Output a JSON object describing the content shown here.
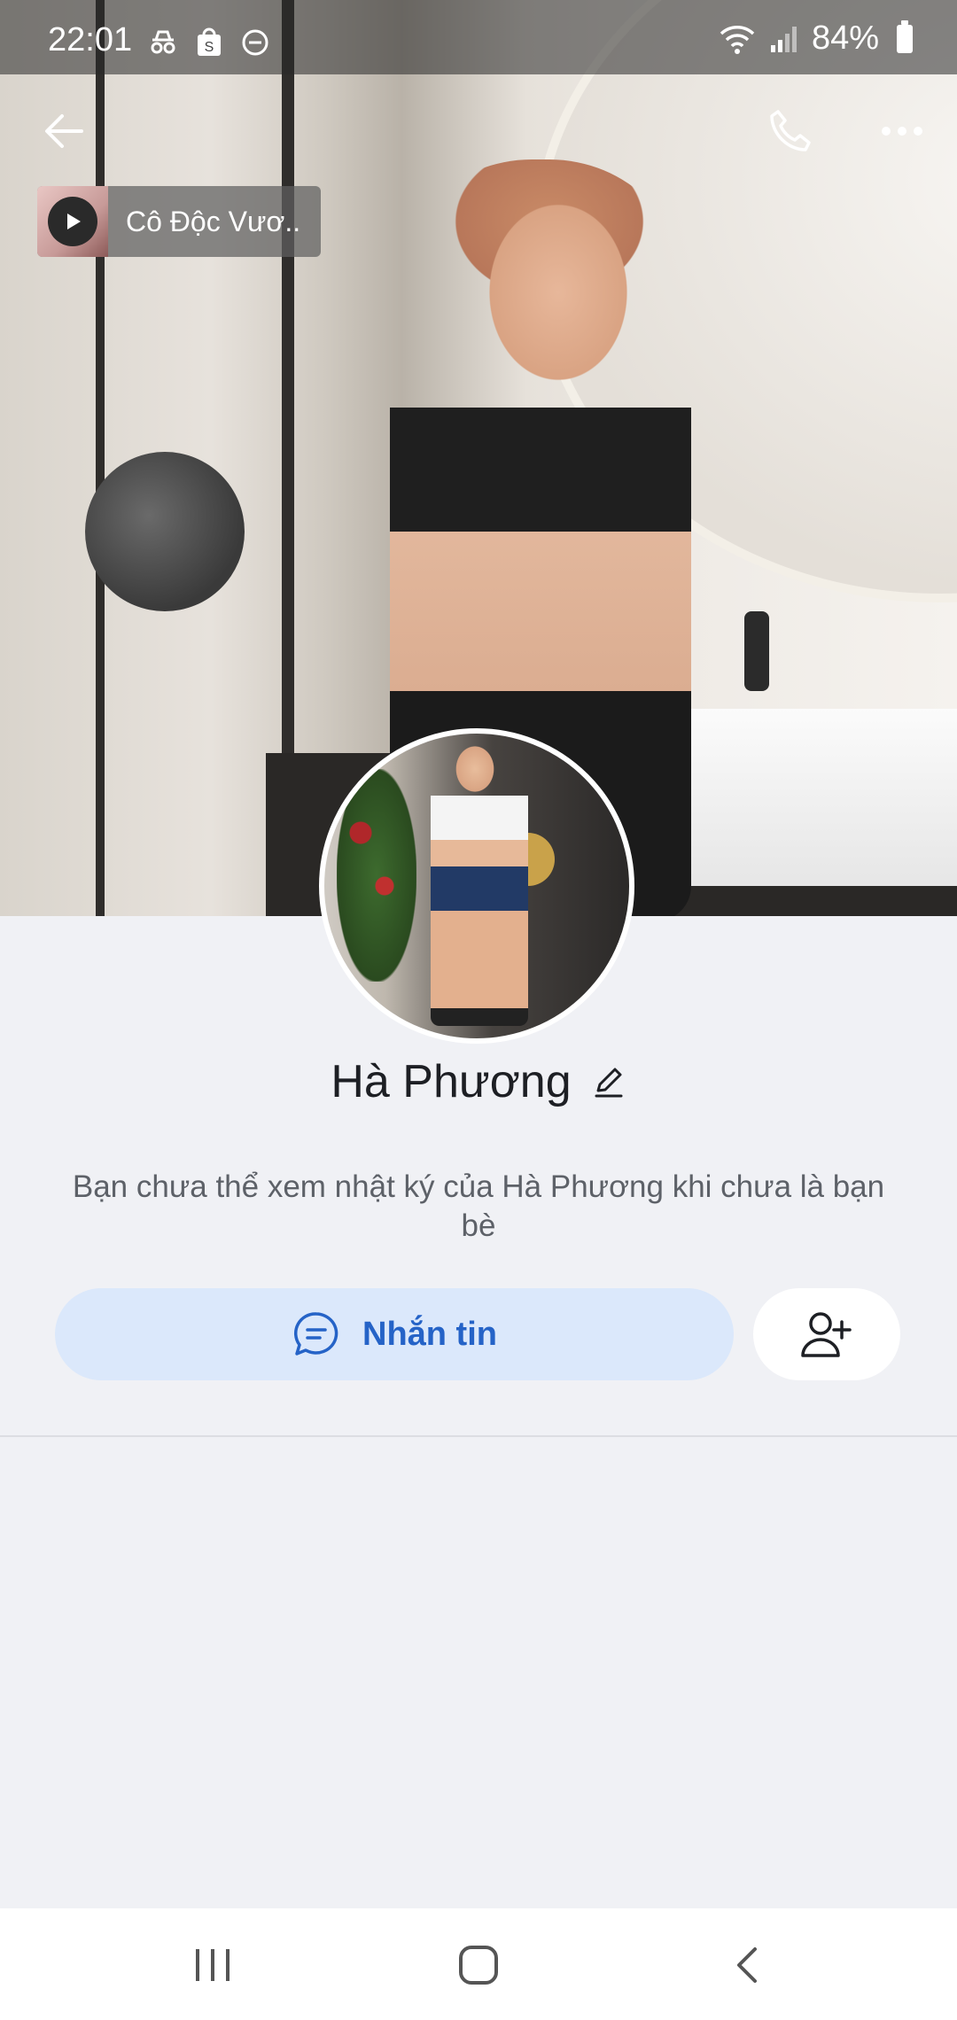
{
  "status_bar": {
    "time": "22:01",
    "battery": "84%",
    "icons": [
      "incognito-icon",
      "shopee-icon",
      "do-not-disturb-icon",
      "wifi-icon",
      "signal-icon",
      "battery-icon"
    ]
  },
  "header": {
    "back_icon": "back-arrow-icon",
    "call_icon": "phone-icon",
    "more_icon": "more-horizontal-icon"
  },
  "music": {
    "title": "Cô Độc Vươ..",
    "icon": "play-icon"
  },
  "profile": {
    "name": "Hà Phương",
    "edit_icon": "pencil-icon",
    "notice": "Bạn chưa thể xem nhật ký của Hà Phương khi chưa là bạn bè"
  },
  "actions": {
    "message_label": "Nhắn tin",
    "message_icon": "chat-bubble-icon",
    "add_friend_icon": "add-friend-icon"
  },
  "nav": {
    "recents_icon": "recents-icon",
    "home_icon": "home-icon",
    "back_icon": "back-chevron-icon"
  },
  "colors": {
    "accent": "#2563c7",
    "message_bg": "#dbe8fb",
    "page_bg": "#f0f1f5"
  }
}
